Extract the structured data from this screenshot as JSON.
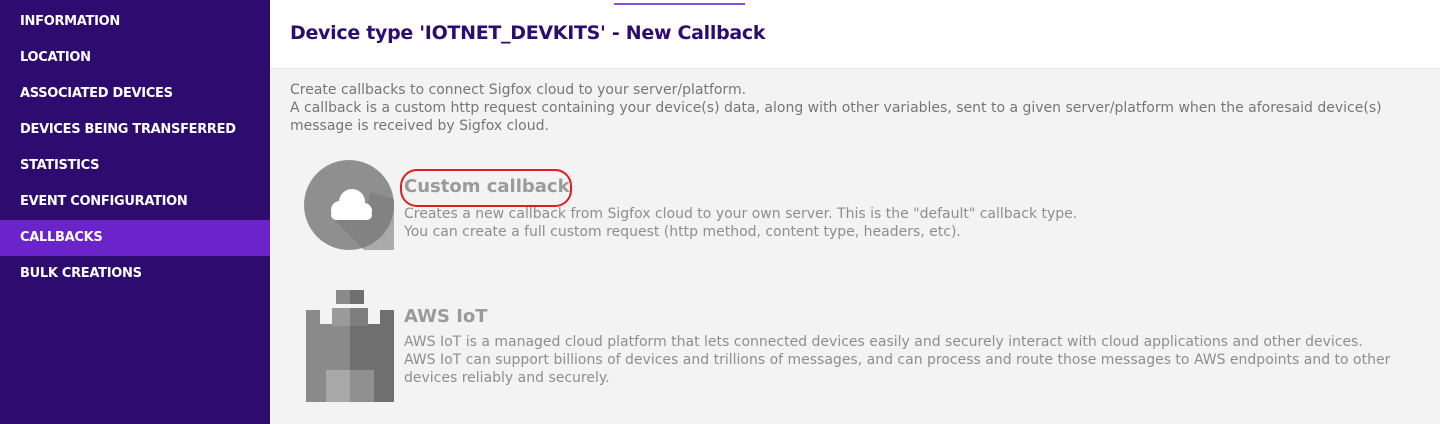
{
  "sidebar": {
    "items": [
      {
        "label": "INFORMATION",
        "active": false
      },
      {
        "label": "LOCATION",
        "active": false
      },
      {
        "label": "ASSOCIATED DEVICES",
        "active": false
      },
      {
        "label": "DEVICES BEING TRANSFERRED",
        "active": false
      },
      {
        "label": "STATISTICS",
        "active": false
      },
      {
        "label": "EVENT CONFIGURATION",
        "active": false
      },
      {
        "label": "CALLBACKS",
        "active": true
      },
      {
        "label": "BULK CREATIONS",
        "active": false
      }
    ]
  },
  "header": {
    "title": "Device type 'IOTNET_DEVKITS' - New Callback"
  },
  "intro": {
    "line1": "Create callbacks to connect Sigfox cloud to your server/platform.",
    "line2": "A callback is a custom http request containing your device(s) data, along with other variables, sent to a given server/platform when the aforesaid device(s) message is received by Sigfox cloud."
  },
  "options": {
    "custom": {
      "icon": "cloud-icon",
      "title": "Custom callback",
      "desc1": "Creates a new callback from Sigfox cloud to your own server. This is the \"default\" callback type.",
      "desc2": "You can create a full custom request (http method, content type, headers, etc)."
    },
    "aws": {
      "icon": "aws-iot-icon",
      "title": "AWS IoT",
      "desc1": "AWS IoT is a managed cloud platform that lets connected devices easily and securely interact with cloud applications and other devices.",
      "desc2": "AWS IoT can support billions of devices and trillions of messages, and can process and route those messages to AWS endpoints and to other devices reliably and securely."
    }
  },
  "colors": {
    "sidebar_bg": "#2e0b6e",
    "sidebar_active": "#6b24c9",
    "title": "#2e0b6e",
    "annotation": "#e31d1d"
  }
}
